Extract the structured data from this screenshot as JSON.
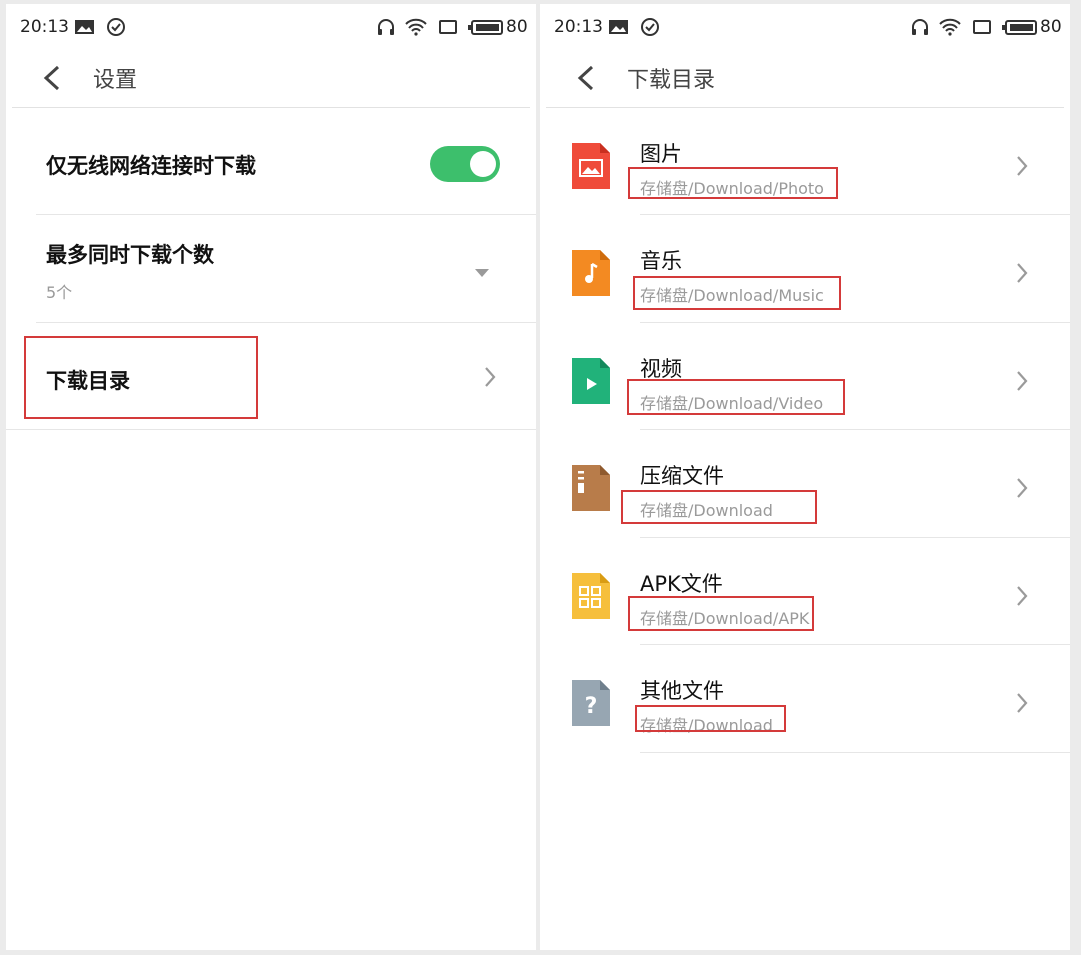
{
  "status": {
    "time": "20:13",
    "battery": "80"
  },
  "left": {
    "title": "设置",
    "wifi_only_label": "仅无线网络连接时下载",
    "wifi_only_enabled": true,
    "max_downloads_label": "最多同时下载个数",
    "max_downloads_value": "5个",
    "download_dir_label": "下载目录"
  },
  "right": {
    "title": "下载目录",
    "items": [
      {
        "label": "图片",
        "path": "存储盘/Download/Photo",
        "icon": "image-file-icon",
        "color": "#ef4b3a"
      },
      {
        "label": "音乐",
        "path": "存储盘/Download/Music",
        "icon": "music-file-icon",
        "color": "#f38a22"
      },
      {
        "label": "视频",
        "path": "存储盘/Download/Video",
        "icon": "video-file-icon",
        "color": "#21b27a"
      },
      {
        "label": "压缩文件",
        "path": "存储盘/Download",
        "icon": "archive-file-icon",
        "color": "#b87c4a"
      },
      {
        "label": "APK文件",
        "path": "存储盘/Download/APK",
        "icon": "apk-file-icon",
        "color": "#f6bf3c"
      },
      {
        "label": "其他文件",
        "path": "存储盘/Download",
        "icon": "unknown-file-icon",
        "color": "#97a6b2"
      }
    ]
  },
  "colors": {
    "toggle_on": "#3dbf6c",
    "highlight_box": "#d43a3a"
  }
}
